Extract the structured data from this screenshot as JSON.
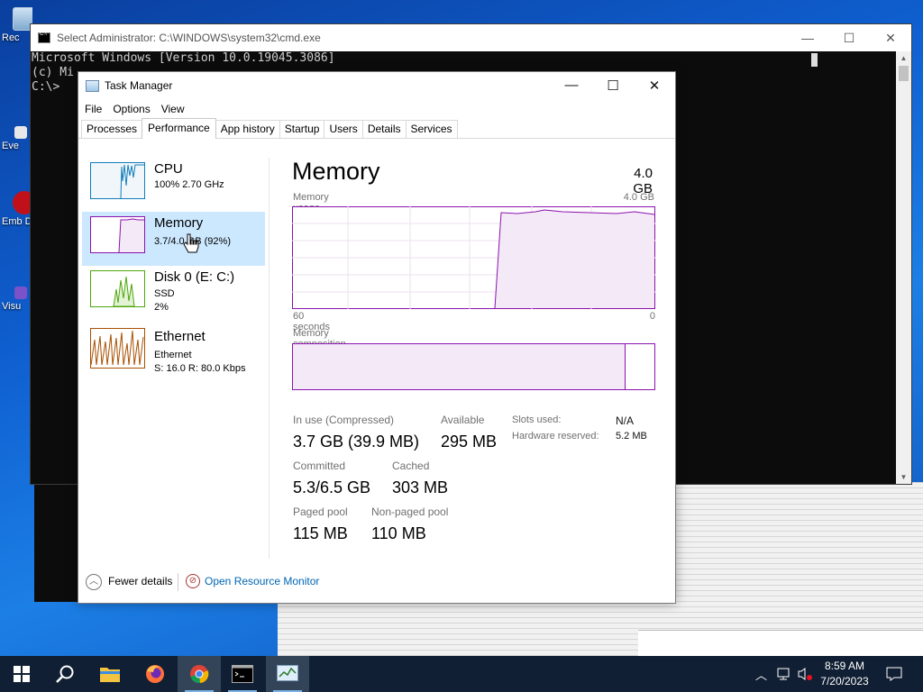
{
  "desktop": {
    "icons": [
      {
        "label": "Rec",
        "icon": "recycle-bin"
      },
      {
        "label": "Eve",
        "icon": "event-viewer"
      },
      {
        "label": "Emb De",
        "icon": "embarcadero-app"
      },
      {
        "label": "Visu",
        "icon": "visual-studio"
      }
    ]
  },
  "cmd": {
    "title": "Select Administrator: C:\\WINDOWS\\system32\\cmd.exe",
    "lines": [
      "Microsoft Windows [Version 10.0.19045.3086]",
      "(c) Mi",
      "",
      "C:\\>"
    ],
    "controls": [
      "—",
      "☐",
      "✕"
    ]
  },
  "task_manager": {
    "title": "Task Manager",
    "controls": [
      "—",
      "☐",
      "✕"
    ],
    "menu": [
      "File",
      "Options",
      "View"
    ],
    "tabs": [
      "Processes",
      "Performance",
      "App history",
      "Startup",
      "Users",
      "Details",
      "Services"
    ],
    "active_tab": "Performance",
    "sidebar": [
      {
        "name": "CPU",
        "line1": "100%  2.70 GHz",
        "line2": "",
        "color": "#117dbb",
        "selected": false
      },
      {
        "name": "Memory",
        "line1": "3.7/4.0 GB (92%)",
        "line2": "",
        "color": "#8b12ae",
        "selected": true
      },
      {
        "name": "Disk 0 (E: C:)",
        "line1": "SSD",
        "line2": "2%",
        "color": "#4da60c",
        "selected": false
      },
      {
        "name": "Ethernet",
        "line1": "Ethernet",
        "line2": "S: 16.0  R: 80.0 Kbps",
        "color": "#a74f01",
        "selected": false
      }
    ],
    "memory": {
      "heading": "Memory",
      "capacity": "4.0 GB",
      "usage_label": "Memory usage",
      "usage_max": "4.0 GB",
      "time_left": "60 seconds",
      "time_right": "0",
      "composition_label": "Memory composition",
      "in_use_fraction": 0.92,
      "stats": {
        "in_use_label": "In use (Compressed)",
        "in_use": "3.7 GB (39.9 MB)",
        "available_label": "Available",
        "available": "295 MB",
        "committed_label": "Committed",
        "committed": "5.3/6.5 GB",
        "cached_label": "Cached",
        "cached": "303 MB",
        "paged_label": "Paged pool",
        "paged": "115 MB",
        "nonpaged_label": "Non-paged pool",
        "nonpaged": "110 MB",
        "slots_label": "Slots used:",
        "slots": "N/A",
        "hw_label": "Hardware reserved:",
        "hw": "5.2 MB"
      }
    },
    "footer": {
      "fewer": "Fewer details",
      "resmon": "Open Resource Monitor"
    }
  },
  "taskbar": {
    "apps": [
      "start-button",
      "search-icon",
      "file-explorer",
      "firefox",
      "chrome",
      "cmd",
      "task-manager"
    ],
    "time": "8:59 AM",
    "date": "7/20/2023"
  }
}
